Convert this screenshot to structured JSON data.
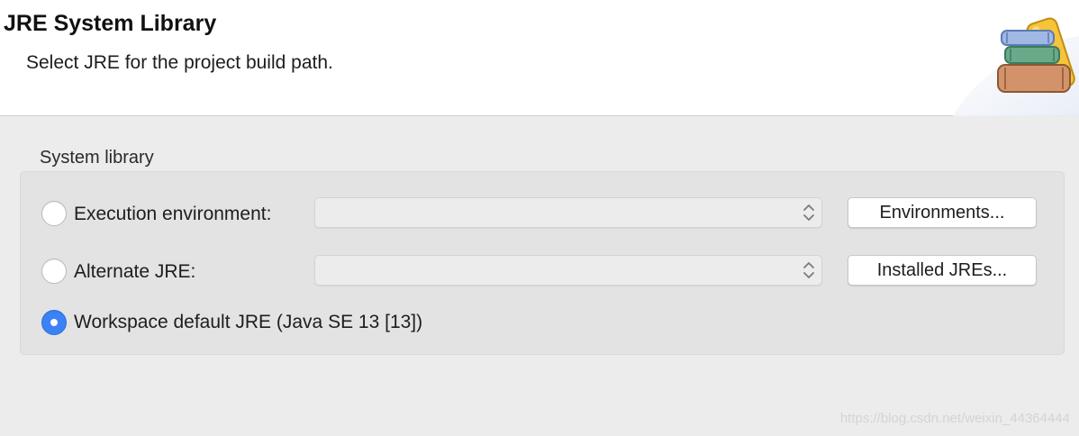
{
  "header": {
    "title": "JRE System Library",
    "description": "Select JRE for the project build path."
  },
  "system_library": {
    "group_label": "System library",
    "options": [
      {
        "label": "Execution environment:",
        "selected": false,
        "combo_value": "",
        "button_label": "Environments..."
      },
      {
        "label": "Alternate JRE:",
        "selected": false,
        "combo_value": "",
        "button_label": "Installed JREs..."
      },
      {
        "label": "Workspace default JRE (Java SE 13 [13])",
        "selected": true
      }
    ]
  },
  "watermark": "https://blog.csdn.net/weixin_44364444",
  "colors": {
    "radio_selected": "#3b82f6",
    "panel_bg": "#ececec",
    "group_bg": "#e3e3e3",
    "header_bg": "#ffffff"
  }
}
